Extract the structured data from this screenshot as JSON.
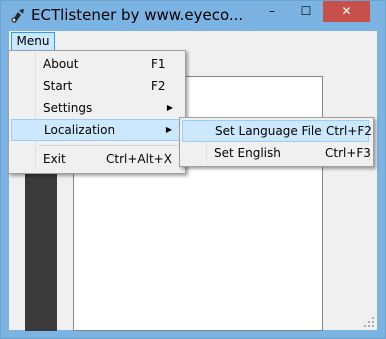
{
  "window": {
    "title": "ECTlistener by www.eyeco...",
    "controls": {
      "minimize": "–",
      "maximize": "☐",
      "close": "✕"
    }
  },
  "menubar": {
    "items": [
      {
        "label": "Menu"
      }
    ]
  },
  "menu": {
    "items": [
      {
        "label": "About",
        "shortcut": "F1"
      },
      {
        "label": "Start",
        "shortcut": "F2"
      },
      {
        "label": "Settings",
        "submenu_arrow": "▶"
      },
      {
        "label": "Localization",
        "submenu_arrow": "▶",
        "highlighted": true
      },
      {
        "label": "Exit",
        "shortcut": "Ctrl+Alt+X"
      }
    ]
  },
  "submenu": {
    "items": [
      {
        "label": "Set Language File",
        "shortcut": "Ctrl+F2",
        "highlighted": true
      },
      {
        "label": "Set English",
        "shortcut": "Ctrl+F3"
      }
    ]
  },
  "colors": {
    "titlebar": "#7bb3e3",
    "close": "#c7504a",
    "highlight": "#cce8ff",
    "panel": "#3a3a3a"
  }
}
